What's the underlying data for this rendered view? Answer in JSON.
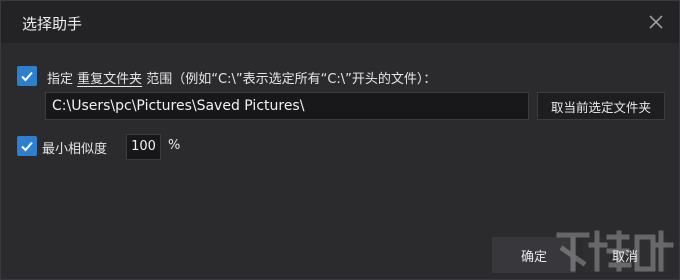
{
  "dialog": {
    "title": "选择助手"
  },
  "scope": {
    "checked": true,
    "prefix": "指定 ",
    "link": "重复文件夹",
    "suffix": " 范围（例如“C:\\”表示选定所有“C:\\”开头的文件）：",
    "path_value": "C:\\Users\\pc\\Pictures\\Saved Pictures\\",
    "pick_button": "取当前选定文件夹"
  },
  "similarity": {
    "checked": true,
    "label": "最小相似度",
    "value": "100",
    "unit": "%"
  },
  "footer": {
    "ok": "确定",
    "cancel": "取消"
  },
  "icons": {
    "close": "close-icon",
    "check": "check-icon",
    "watermark": "watermark-logo"
  },
  "colors": {
    "accent": "#2f7fd0",
    "background": "#2b2b2e",
    "titlebar": "#232326"
  }
}
